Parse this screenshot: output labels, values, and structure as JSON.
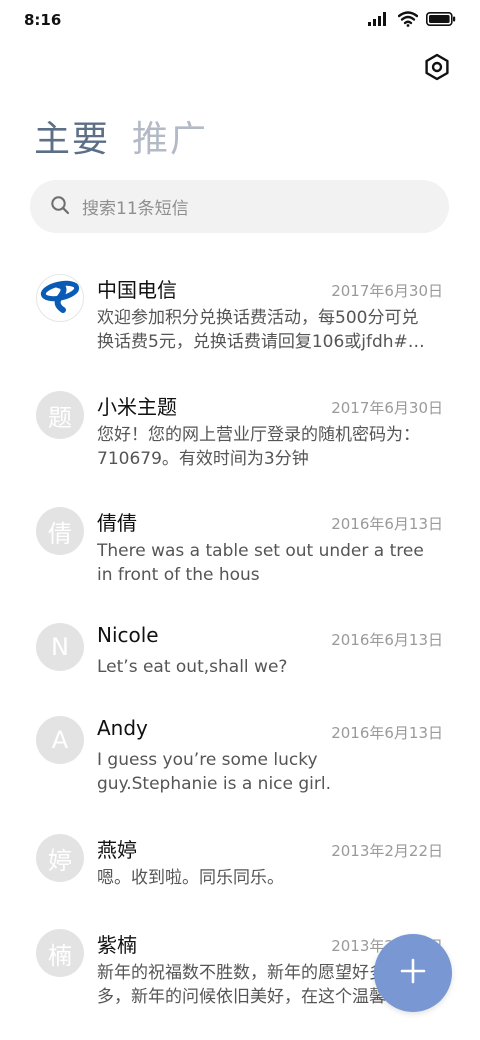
{
  "status_bar": {
    "time": "8:16",
    "icons": [
      "signal-icon",
      "wifi-icon",
      "battery-icon"
    ]
  },
  "header": {
    "settings_icon": "settings-hexagon-icon",
    "tabs": [
      {
        "label": "主要",
        "active": true
      },
      {
        "label": "推广",
        "active": false
      }
    ]
  },
  "search": {
    "icon": "search-icon",
    "placeholder": "搜索11条短信"
  },
  "conversations": [
    {
      "avatar": "",
      "avatar_icon": "china-telecom-logo",
      "name": "中国电信",
      "date": "2017年6月30日",
      "preview": "欢迎参加积分兑换话费活动，每500分可兑换话费5元，兑换话费请回复106或jfdh#…"
    },
    {
      "avatar": "题",
      "name": "小米主题",
      "date": "2017年6月30日",
      "preview": "您好！您的网上营业厅登录的随机密码为：710679。有效时间为3分钟"
    },
    {
      "avatar": "倩",
      "name": "倩倩",
      "date": "2016年6月13日",
      "preview": "There was a table set out under a tree in front of the hous"
    },
    {
      "avatar": "N",
      "name": "Nicole",
      "date": "2016年6月13日",
      "preview": "Let’s eat out,shall we?"
    },
    {
      "avatar": "A",
      "name": "Andy",
      "date": "2016年6月13日",
      "preview": "I guess you’re some lucky guy.Stephanie is a nice girl."
    },
    {
      "avatar": "婷",
      "name": "燕婷",
      "date": "2013年2月22日",
      "preview": "嗯。收到啦。同乐同乐。"
    },
    {
      "avatar": "楠",
      "name": "紫楠",
      "date": "2013年2月22日",
      "preview": "新年的祝福数不胜数，新年的愿望好多好多，新年的问候依旧美好，在这个温馨"
    }
  ],
  "fab": {
    "icon": "plus-icon",
    "accent": "#7897d3"
  },
  "colors": {
    "tab_active": "#5d6f87",
    "tab_inactive": "#b3bac6",
    "search_bg": "#f2f2f2",
    "avatar_bg": "#e3e3e3",
    "telecom_blue": "#0a5bb5"
  }
}
